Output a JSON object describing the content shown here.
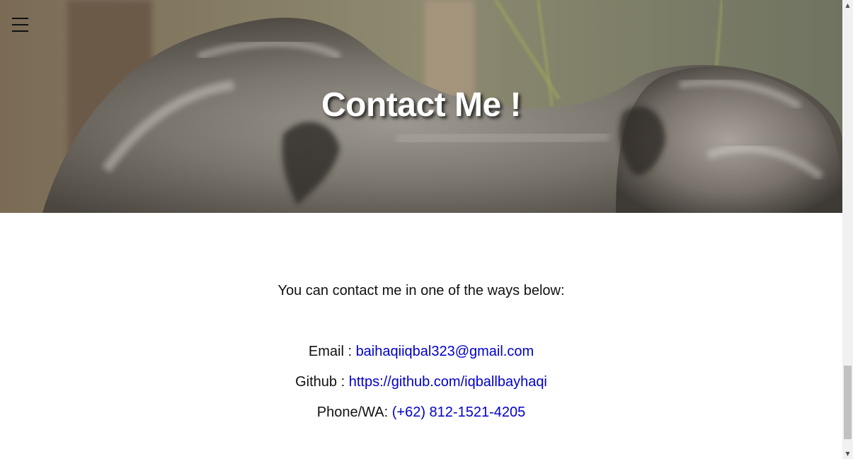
{
  "hero": {
    "title": "Contact Me !",
    "menu_icon": "hamburger-menu-icon",
    "image": "koala-fur-photo"
  },
  "content": {
    "intro": "You can contact me in one of the ways below:",
    "contacts": [
      {
        "label": "Email : ",
        "value": "baihaqiiqbal323@gmail.com"
      },
      {
        "label": "Github : ",
        "value": "https://github.com/iqballbayhaqi"
      },
      {
        "label": "Phone/WA: ",
        "value": "(+62) 812-1521-4205"
      }
    ]
  },
  "scrollbar": {
    "up_icon": "scroll-up-arrow-icon",
    "down_icon": "scroll-down-arrow-icon"
  },
  "colors": {
    "link": "#0000cc",
    "text": "#111111",
    "title": "#ffffff"
  }
}
